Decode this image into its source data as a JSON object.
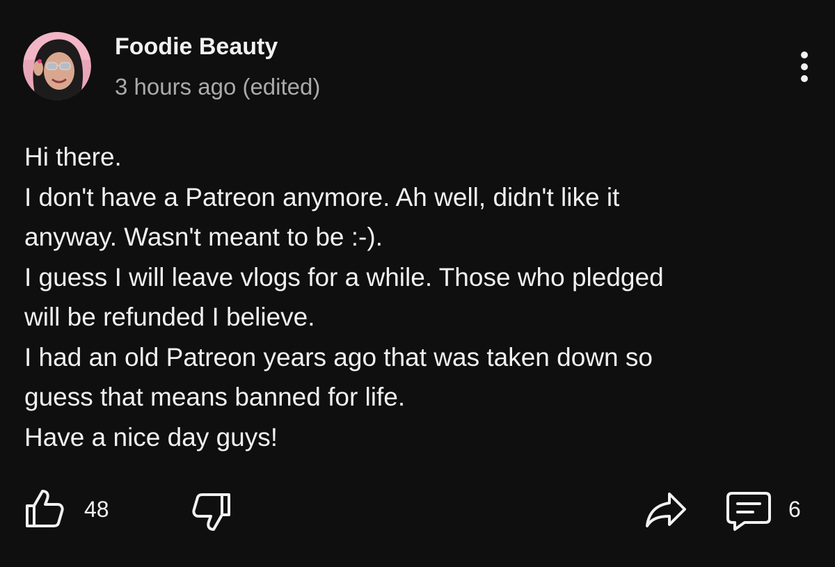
{
  "post": {
    "author": "Foodie Beauty",
    "timestamp": "3 hours ago (edited)",
    "lines": [
      "Hi there.",
      "I don't have a Patreon anymore. Ah well, didn't like it",
      "anyway. Wasn't meant to be :-).",
      "I guess I will leave vlogs for a while. Those who pledged",
      "will be refunded I believe.",
      "I had an old Patreon years ago that was taken down so",
      "guess that means banned for life.",
      "Have a nice day guys!"
    ]
  },
  "actions": {
    "like_count": "48",
    "comment_count": "6"
  },
  "icons": {
    "menu": "more-vertical-icon",
    "like": "thumbs-up-icon",
    "dislike": "thumbs-down-icon",
    "share": "share-icon",
    "comment": "comment-icon"
  },
  "colors": {
    "background": "#0f0f0f",
    "text": "#f1f1f1",
    "secondary_text": "#aaaaaa"
  }
}
